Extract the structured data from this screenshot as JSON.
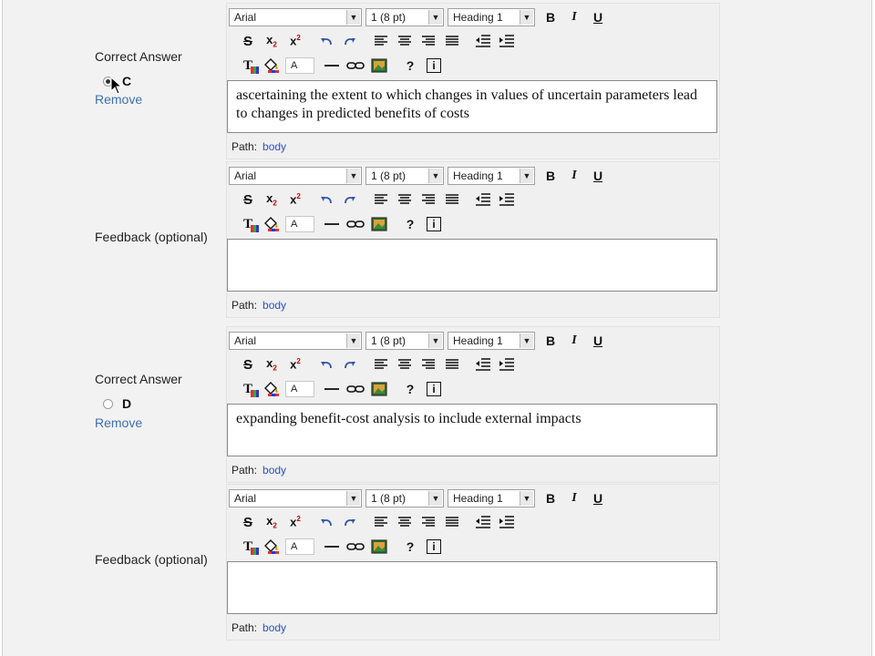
{
  "toolbar": {
    "font": "Arial",
    "size": "1 (8 pt)",
    "format": "Heading 1",
    "bold": "B",
    "italic": "I",
    "underline": "U",
    "strike": "S",
    "subscript": "x",
    "subscript_mark": "2",
    "superscript": "x",
    "superscript_mark": "2",
    "text_color_glyph": "T",
    "font_color_box": "A",
    "help": "?",
    "info": "i"
  },
  "path_label": "Path:",
  "path_link": "body",
  "answer_c": {
    "label": "Correct Answer",
    "letter": "C",
    "selected": true,
    "remove": "Remove",
    "text": "ascertaining the extent to which changes in values of uncertain parameters lead to changes in predicted benefits of costs"
  },
  "feedback_c": {
    "label": "Feedback (optional)",
    "text": ""
  },
  "answer_d": {
    "label": "Correct Answer",
    "letter": "D",
    "selected": false,
    "remove": "Remove",
    "text": "expanding benefit-cost analysis to include external impacts"
  },
  "feedback_d": {
    "label": "Feedback (optional)",
    "text": ""
  },
  "colors": {
    "link": "#2a52c8",
    "remove": "#3e6fb0",
    "panel": "#f2f2f2"
  }
}
